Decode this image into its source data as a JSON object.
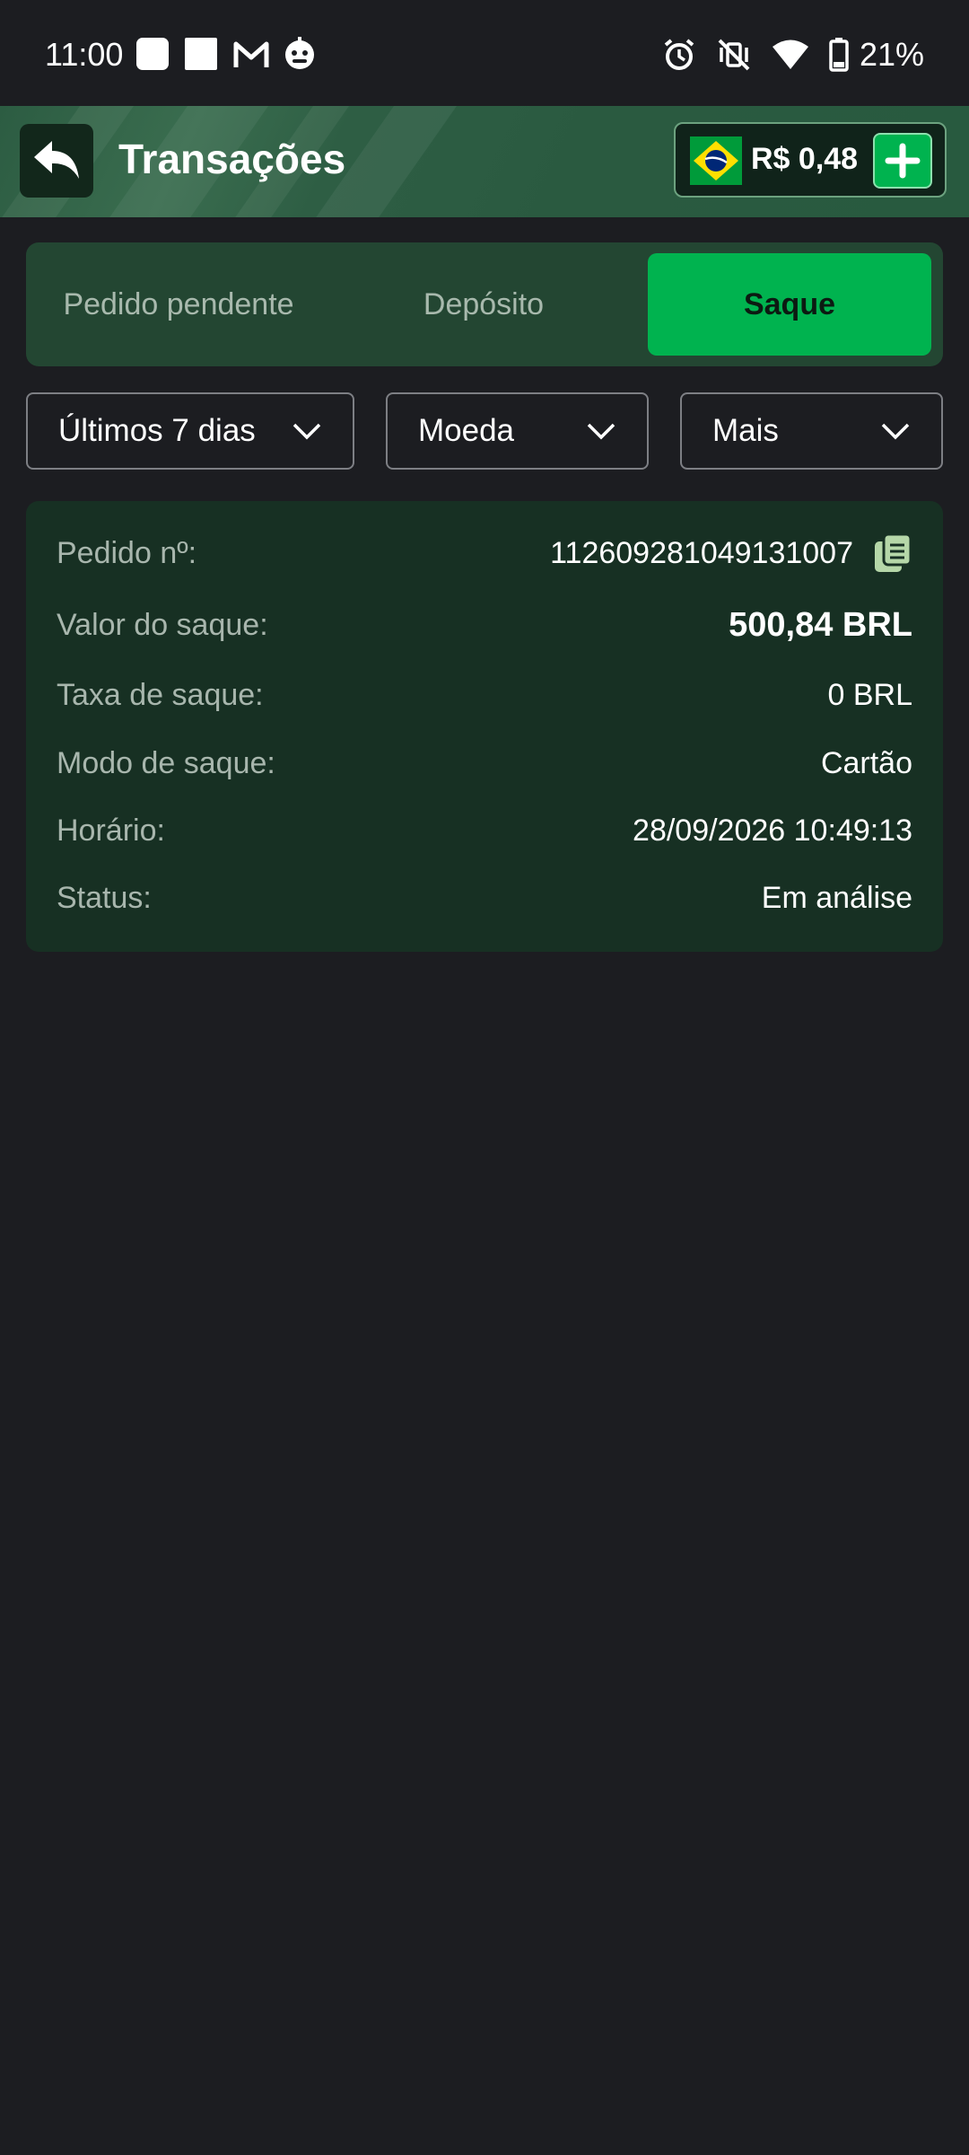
{
  "status_bar": {
    "time": "11:00",
    "battery_percent": "21%",
    "left_icons": [
      "app-square-icon",
      "app-square-icon",
      "gmail-icon",
      "bot-icon"
    ],
    "right_icons": [
      "alarm-icon",
      "vibrate-off-icon",
      "wifi-icon",
      "battery-icon"
    ]
  },
  "header": {
    "title": "Transações",
    "balance": "R$ 0,48",
    "back_icon": "back-arrow-icon",
    "flag_icon": "brazil-flag-icon",
    "add_icon": "plus-icon"
  },
  "tabs": [
    {
      "label": "Pedido pendente",
      "active": false
    },
    {
      "label": "Depósito",
      "active": false
    },
    {
      "label": "Saque",
      "active": true
    }
  ],
  "filters": [
    {
      "label": "Últimos 7 dias"
    },
    {
      "label": "Moeda"
    },
    {
      "label": "Mais"
    }
  ],
  "transaction": {
    "order_label": "Pedido nº:",
    "order_value": "112609281049131007",
    "amount_label": "Valor do saque:",
    "amount_value": "500,84 BRL",
    "fee_label": "Taxa de saque:",
    "fee_value": "0 BRL",
    "mode_label": "Modo de saque:",
    "mode_value": "Cartão",
    "time_label": "Horário:",
    "time_value": "28/09/2026 10:49:13",
    "status_label": "Status:",
    "status_value": "Em análise"
  },
  "colors": {
    "background": "#1c1d21",
    "accent": "#00b34f",
    "card": "#173023",
    "tabs_bg": "#234632"
  }
}
